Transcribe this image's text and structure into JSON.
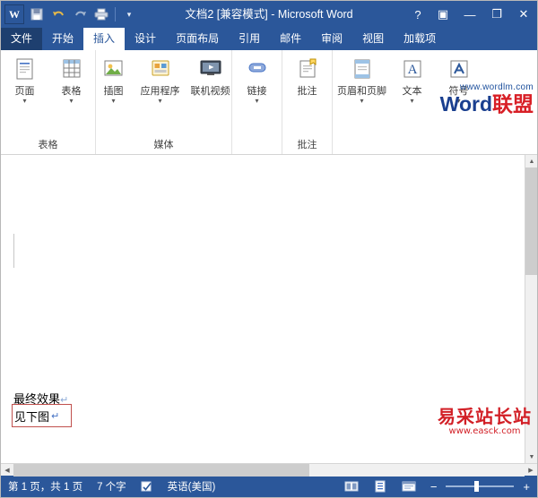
{
  "window": {
    "title": "文档2 [兼容模式] - Microsoft Word",
    "logo_text": "W",
    "quick_access": [
      {
        "name": "save",
        "glyph": "save-icon"
      },
      {
        "name": "undo",
        "glyph": "undo-icon"
      },
      {
        "name": "redo",
        "glyph": "redo-icon"
      },
      {
        "name": "quick-print",
        "glyph": "print-icon"
      },
      {
        "name": "customize",
        "glyph": "chevron-down-icon"
      }
    ],
    "help_label": "?",
    "ribbon_display_label": "▣",
    "minimize_label": "—",
    "restore_label": "❐",
    "close_label": "✕"
  },
  "tabs": [
    {
      "label": "文件",
      "active": false,
      "file": true
    },
    {
      "label": "开始",
      "active": false
    },
    {
      "label": "插入",
      "active": true
    },
    {
      "label": "设计",
      "active": false
    },
    {
      "label": "页面布局",
      "active": false
    },
    {
      "label": "引用",
      "active": false
    },
    {
      "label": "邮件",
      "active": false
    },
    {
      "label": "审阅",
      "active": false
    },
    {
      "label": "视图",
      "active": false
    },
    {
      "label": "加载项",
      "active": false
    }
  ],
  "ribbon": {
    "groups": [
      {
        "label": "表格",
        "items": [
          {
            "label": "页面",
            "icon": "page-icon",
            "caret": true
          },
          {
            "label": "表格",
            "icon": "table-icon",
            "caret": true
          }
        ]
      },
      {
        "label": "",
        "items": [
          {
            "label": "插图",
            "icon": "illustration-icon",
            "caret": true
          },
          {
            "label": "应用程序",
            "icon": "apps-icon",
            "caret": true
          },
          {
            "label": "联机视频",
            "icon": "online-video-icon",
            "caret": false
          }
        ]
      },
      {
        "label": "媒体",
        "items": [
          {
            "label": "链接",
            "icon": "link-icon",
            "caret": true
          }
        ]
      },
      {
        "label": "批注",
        "items": [
          {
            "label": "批注",
            "icon": "comment-icon",
            "caret": false
          }
        ]
      },
      {
        "label": "",
        "items": [
          {
            "label": "页眉和页脚",
            "icon": "header-footer-icon",
            "caret": true
          },
          {
            "label": "文本",
            "icon": "text-icon",
            "caret": true
          },
          {
            "label": "符号",
            "icon": "symbol-icon",
            "caret": true
          }
        ]
      }
    ],
    "watermark": {
      "url": "www.wordlm.com",
      "brand_left": "Word",
      "brand_right": "联盟"
    }
  },
  "document": {
    "paragraph_1": "最终效果",
    "paragraph_1_mark": "↵",
    "boxed_text": "见下图",
    "boxed_mark": "↵"
  },
  "status_bar": {
    "page_info": "第 1 页，共 1 页",
    "word_count": "7 个字",
    "proofing_icon": "spelling-check-icon",
    "language": "英语(美国)",
    "view_read": "read-mode-icon",
    "view_print": "print-layout-icon",
    "view_web": "web-layout-icon",
    "zoom_minus": "−",
    "zoom_plus": "+",
    "zoom_level": ""
  },
  "page_watermark": {
    "main": "易采站长站",
    "sub": "www.easck.com"
  }
}
